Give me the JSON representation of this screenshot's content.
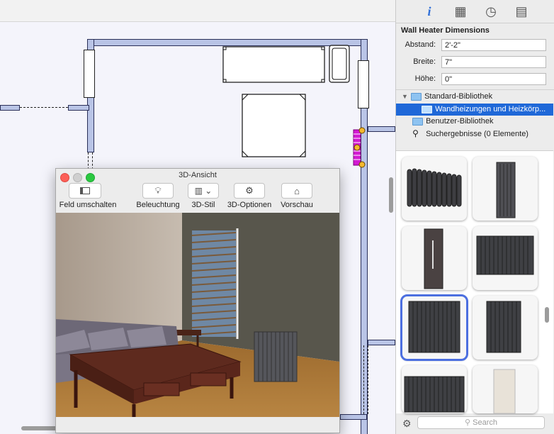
{
  "sidebar": {
    "tabs": [
      {
        "icon": "info-icon",
        "glyph": "i"
      },
      {
        "icon": "chair-icon",
        "glyph": "▦"
      },
      {
        "icon": "stopwatch-icon",
        "glyph": "◷"
      },
      {
        "icon": "book-icon",
        "glyph": "▤"
      }
    ],
    "section_title": "Wall Heater Dimensions",
    "fields": [
      {
        "label": "Abstand:",
        "value": "2'-2\""
      },
      {
        "label": "Breite:",
        "value": "7\""
      },
      {
        "label": "Höhe:",
        "value": "0\""
      }
    ],
    "tree": [
      {
        "label": "Standard-Bibliothek"
      },
      {
        "label": "Wandheizungen und Heizkörp..."
      },
      {
        "label": "Benutzer-Bibliothek"
      },
      {
        "label": "Suchergebnisse (0 Elemente)"
      }
    ],
    "search_placeholder": "Search",
    "accent_color": "#2f6fd8",
    "selection_color": "#4c6fe0"
  },
  "window": {
    "title": "3D-Ansicht",
    "toolbar": [
      {
        "label": "Feld umschalten",
        "icon": "panel-toggle-icon"
      },
      {
        "label": "Beleuchtung",
        "icon": "lightbulb-icon"
      },
      {
        "label": "3D-Stil",
        "icon": "paint-bucket-icon"
      },
      {
        "label": "3D-Optionen",
        "icon": "gear-icon"
      },
      {
        "label": "Vorschau",
        "icon": "house-icon"
      }
    ]
  }
}
